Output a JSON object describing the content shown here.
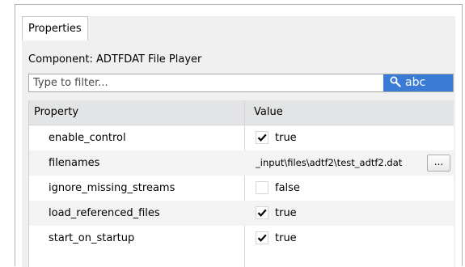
{
  "tabs": [
    {
      "label": "Properties",
      "active": true
    }
  ],
  "component": {
    "label": "Component: ADTFDAT File Player"
  },
  "filter": {
    "placeholder": "Type to filter...",
    "value": "",
    "mode_label": "abc",
    "mode_icon": "search-icon",
    "mode_color": "#3a7bd5"
  },
  "table": {
    "columns": [
      "Property",
      "Value"
    ],
    "rows": [
      {
        "name": "enable_control",
        "type": "bool",
        "checked": true,
        "value": "true"
      },
      {
        "name": "filenames",
        "type": "file",
        "value": "_input\\files\\adtf2\\test_adtf2.dat",
        "button": "..."
      },
      {
        "name": "ignore_missing_streams",
        "type": "bool",
        "checked": false,
        "value": "false"
      },
      {
        "name": "load_referenced_files",
        "type": "bool",
        "checked": true,
        "value": "true"
      },
      {
        "name": "start_on_startup",
        "type": "bool",
        "checked": true,
        "value": "true"
      }
    ]
  }
}
